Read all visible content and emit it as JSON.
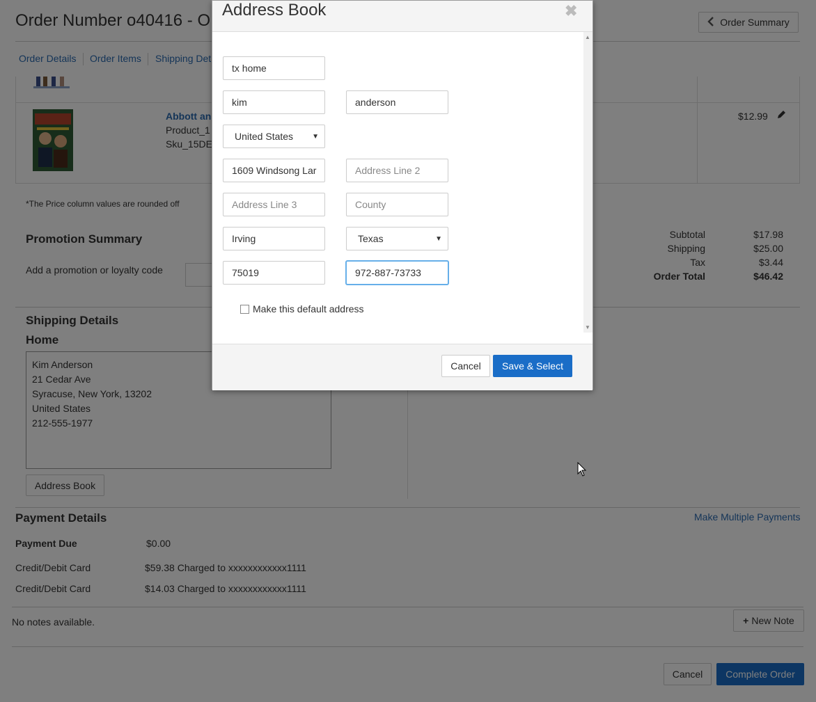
{
  "page": {
    "title": "Order Number o40416 - O",
    "order_summary_label": "Order Summary",
    "tabs": [
      "Order Details",
      "Order Items",
      "Shipping Det"
    ],
    "product": {
      "name": "Abbott an",
      "line1": "Product_1",
      "line2": "Sku_15DE",
      "price": "$12.99"
    },
    "price_note": "*The Price column values are rounded off",
    "promotion": {
      "title": "Promotion Summary",
      "label": "Add a promotion or loyalty code"
    },
    "totals": [
      {
        "label": "Subtotal",
        "value": "$17.98"
      },
      {
        "label": "Shipping",
        "value": "$25.00"
      },
      {
        "label": "Tax",
        "value": "$3.44"
      },
      {
        "label": "Order Total",
        "value": "$46.42"
      }
    ],
    "shipping": {
      "title": "Shipping Details",
      "subtitle": "Home",
      "address_lines": [
        "Kim Anderson",
        "21 Cedar Ave",
        "Syracuse, New York, 13202",
        "United States",
        "212-555-1977"
      ],
      "address_book_label": "Address Book"
    },
    "payment": {
      "title": "Payment Details",
      "multi_link": "Make Multiple Payments",
      "due_label": "Payment Due",
      "due_value": "$0.00",
      "rows": [
        {
          "label": "Credit/Debit Card",
          "value": "$59.38 Charged to xxxxxxxxxxxx1111"
        },
        {
          "label": "Credit/Debit Card",
          "value": "$14.03 Charged to xxxxxxxxxxxx1111"
        }
      ]
    },
    "notes": {
      "empty_text": "No notes available.",
      "new_note_label": "New Note"
    },
    "footer": {
      "cancel_label": "Cancel",
      "complete_label": "Complete Order"
    }
  },
  "modal": {
    "title": "Address Book",
    "close_icon": "close-icon",
    "fields": {
      "nickname": {
        "value": "tx home",
        "placeholder": ""
      },
      "first_name": {
        "value": "kim",
        "placeholder": ""
      },
      "last_name": {
        "value": "anderson",
        "placeholder": ""
      },
      "country": {
        "value": "United States"
      },
      "address1": {
        "value": "1609 Windsong Lar",
        "placeholder": ""
      },
      "address2": {
        "value": "",
        "placeholder": "Address Line 2"
      },
      "address3": {
        "value": "",
        "placeholder": "Address Line 3"
      },
      "county": {
        "value": "",
        "placeholder": "County"
      },
      "city": {
        "value": "Irving",
        "placeholder": ""
      },
      "state": {
        "value": "Texas"
      },
      "zip": {
        "value": "75019",
        "placeholder": ""
      },
      "phone": {
        "value": "972-887-73733",
        "placeholder": ""
      }
    },
    "default_checkbox_label": "Make this default address",
    "default_checked": false,
    "cancel_label": "Cancel",
    "save_label": "Save & Select"
  },
  "colors": {
    "primary": "#1a6dc7",
    "link": "#2a6ab0"
  }
}
